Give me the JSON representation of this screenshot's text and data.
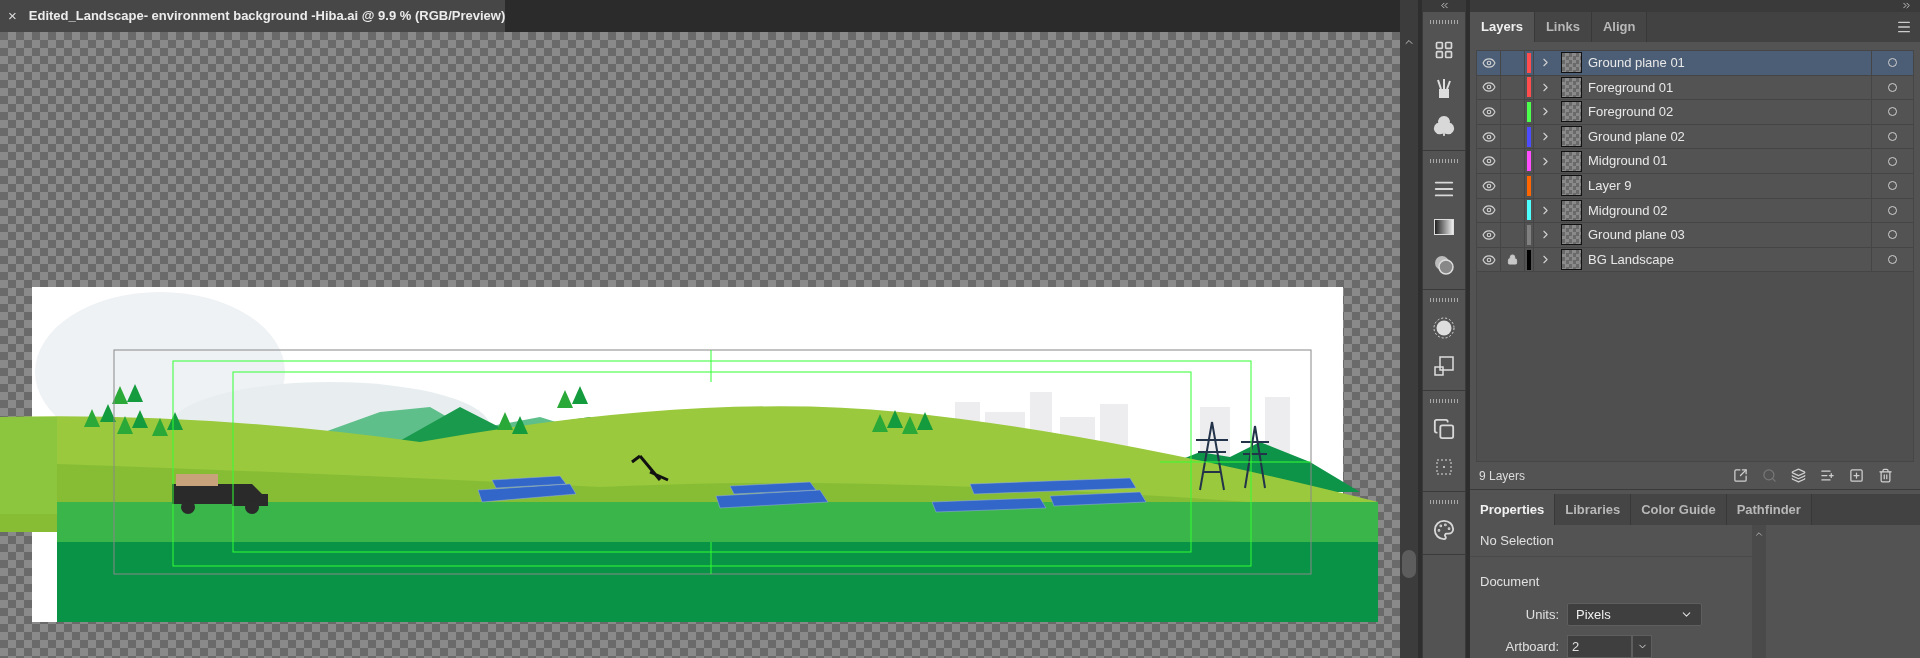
{
  "document_tab": {
    "title": "Edited_Landscape- environment background -Hiba.ai @ 9.9 % (RGB/Preview)",
    "close": "×"
  },
  "layers_panel": {
    "tabs": [
      {
        "label": "Layers",
        "selected": true
      },
      {
        "label": "Links",
        "selected": false
      },
      {
        "label": "Align",
        "selected": false
      }
    ],
    "layers": [
      {
        "name": "Ground plane 01",
        "color": "#ff4d4d",
        "visible": true,
        "locked": false,
        "expandable": true,
        "selected": true
      },
      {
        "name": "Foreground 01",
        "color": "#ff4d4d",
        "visible": true,
        "locked": false,
        "expandable": true,
        "selected": false
      },
      {
        "name": "Foreground 02",
        "color": "#4dff4d",
        "visible": true,
        "locked": false,
        "expandable": true,
        "selected": false
      },
      {
        "name": "Ground plane 02",
        "color": "#4d4dff",
        "visible": true,
        "locked": false,
        "expandable": true,
        "selected": false
      },
      {
        "name": "Midground 01",
        "color": "#ff4dff",
        "visible": true,
        "locked": false,
        "expandable": true,
        "selected": false
      },
      {
        "name": "Layer 9",
        "color": "#ff6600",
        "visible": true,
        "locked": false,
        "expandable": false,
        "selected": false
      },
      {
        "name": "Midground 02",
        "color": "#4dffff",
        "visible": true,
        "locked": false,
        "expandable": true,
        "selected": false
      },
      {
        "name": "Ground plane 03",
        "color": "#808080",
        "visible": true,
        "locked": false,
        "expandable": true,
        "selected": false
      },
      {
        "name": "BG Landscape",
        "color": "#000000",
        "visible": true,
        "locked": true,
        "expandable": true,
        "selected": false
      }
    ],
    "count": "9 Layers"
  },
  "properties_panel": {
    "tabs": [
      {
        "label": "Properties",
        "selected": true
      },
      {
        "label": "Libraries",
        "selected": false
      },
      {
        "label": "Color Guide",
        "selected": false
      },
      {
        "label": "Pathfinder",
        "selected": false
      }
    ],
    "selection": "No Selection",
    "section": "Document",
    "units": {
      "label": "Units:",
      "value": "Pixels"
    },
    "artboard": {
      "label": "Artboard:",
      "value": "2"
    }
  }
}
